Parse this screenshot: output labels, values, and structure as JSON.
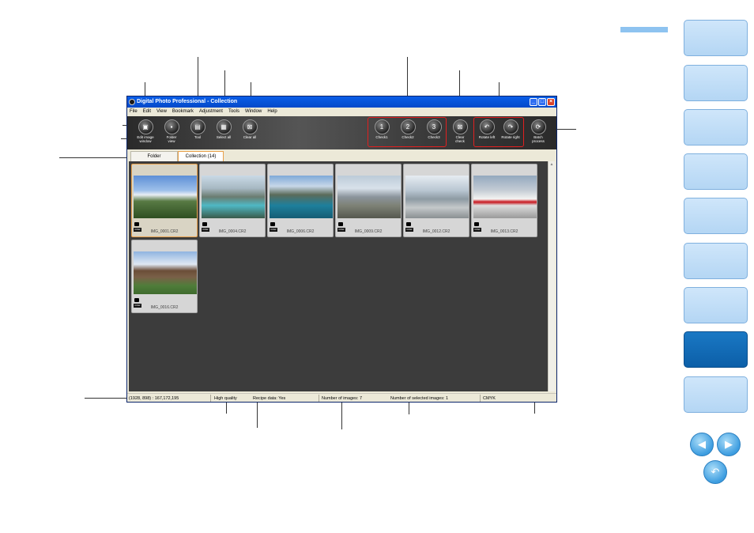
{
  "window": {
    "title": "Digital Photo Professional - Collection"
  },
  "menu": [
    "File",
    "Edit",
    "View",
    "Bookmark",
    "Adjustment",
    "Tools",
    "Window",
    "Help"
  ],
  "toolbar": {
    "edit_image_window": "Edit image\nwindow",
    "folder_view": "Folder\nview",
    "tool": "Tool",
    "select_all": "Select all",
    "clear_all": "Clear all",
    "check1": "Check1",
    "check2": "Check2",
    "check3": "Check3",
    "clear_check": "Clear\ncheck",
    "rotate_left": "Rotate left",
    "rotate_right": "Rotate right",
    "batch_process": "Batch\nprocess",
    "check1_glyph": "1",
    "check2_glyph": "2",
    "check3_glyph": "3"
  },
  "tabs": {
    "folder": "Folder",
    "collection": "Collection (14)"
  },
  "thumbnails": [
    {
      "filename": "IMG_0001.CR2",
      "badge": "RAW"
    },
    {
      "filename": "IMG_0004.CR2",
      "badge": "RAW"
    },
    {
      "filename": "IMG_0006.CR2",
      "badge": "RAW"
    },
    {
      "filename": "IMG_0009.CR2",
      "badge": "RAW"
    },
    {
      "filename": "IMG_0012.CR2",
      "badge": "RAW"
    },
    {
      "filename": "IMG_0013.CR2",
      "badge": "RAW"
    },
    {
      "filename": "IMG_0016.CR2",
      "badge": "RAW"
    }
  ],
  "statusbar": {
    "coords": "(1928, 898) : 167,172,195",
    "quality": "High quality",
    "recipe": "Recipe data: Yes",
    "num_images": "Number of images: 7",
    "num_selected": "Number of selected images: 1",
    "color_mode": "CMYK"
  },
  "icons": {
    "nav_prev": "◀",
    "nav_next": "▶",
    "nav_back": "↶"
  },
  "colors": {
    "highlight": "#e02020",
    "selection": "#e8a04a",
    "nav_active": "#0c5fa8"
  }
}
